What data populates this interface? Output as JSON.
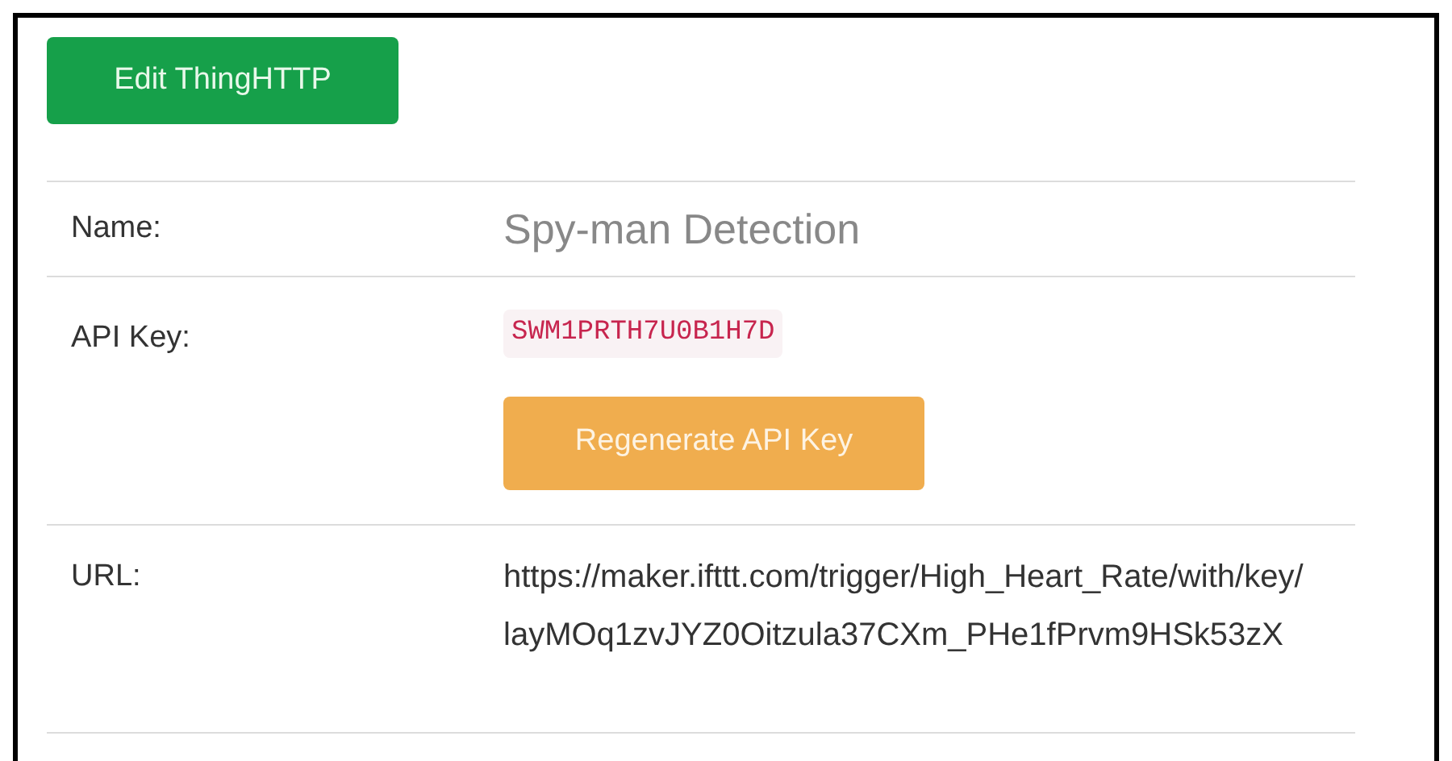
{
  "header_button": "Edit ThingHTTP",
  "rows": [
    {
      "kind": "name",
      "label": "Name:",
      "value": "Spy-man Detection"
    },
    {
      "kind": "api_key",
      "label": "API Key:",
      "value": "SWM1PRTH7U0B1H7D",
      "button": "Regenerate API Key"
    },
    {
      "kind": "url",
      "label": "URL:",
      "value": "https://maker.ifttt.com/trigger/High_Heart_Rate/with/key/layMOq1zvJYZ0Oitzula37CXm_PHe1fPrvm9HSk53zX"
    }
  ]
}
